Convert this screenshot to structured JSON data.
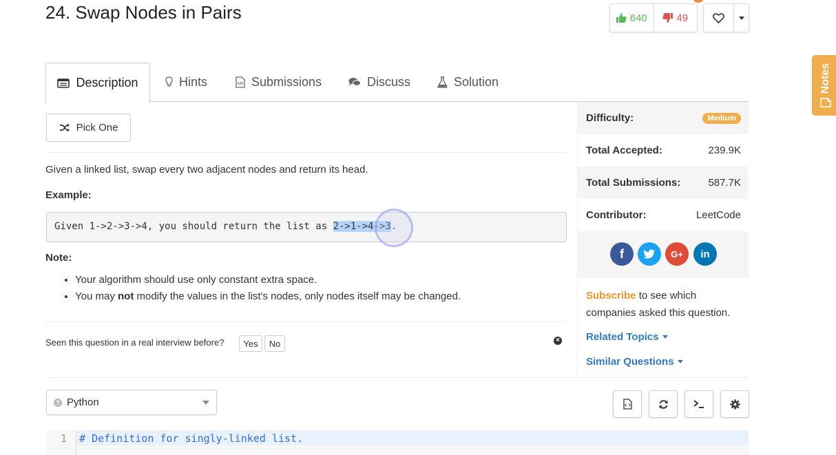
{
  "problem": {
    "title": "24. Swap Nodes in Pairs"
  },
  "votes": {
    "up": "640",
    "down": "49"
  },
  "tabs": [
    {
      "label": "Description",
      "icon": "description-icon"
    },
    {
      "label": "Hints",
      "icon": "lightbulb-icon"
    },
    {
      "label": "Submissions",
      "icon": "code-file-icon"
    },
    {
      "label": "Discuss",
      "icon": "comments-icon"
    },
    {
      "label": "Solution",
      "icon": "flask-icon"
    }
  ],
  "notes_tab": {
    "label": "Notes"
  },
  "pick_one": {
    "label": "Pick One"
  },
  "description": {
    "intro": "Given a linked list, swap every two adjacent nodes and return its head.",
    "example_heading": "Example:",
    "example_prefix": "Given 1->2->3->4, you should return the list as ",
    "example_highlight": "2->1->4->3",
    "example_suffix": ".",
    "note_heading": "Note:",
    "note_1": "Your algorithm should use only constant extra space.",
    "note_2_a": "You may ",
    "note_2_bold": "not",
    "note_2_b": " modify the values in the list's nodes, only nodes itself may be changed."
  },
  "interview": {
    "question": "Seen this question in a real interview before?",
    "yes": "Yes",
    "no": "No"
  },
  "sidebar": {
    "difficulty_label": "Difficulty:",
    "difficulty_value": "Medium",
    "accepted_label": "Total Accepted:",
    "accepted_value": "239.9K",
    "submissions_label": "Total Submissions:",
    "submissions_value": "587.7K",
    "contributor_label": "Contributor:",
    "contributor_value": "LeetCode",
    "subscribe_link": "Subscribe",
    "subscribe_text": " to see which companies asked this question.",
    "related_topics": "Related Topics",
    "similar_questions": "Similar Questions"
  },
  "social": [
    {
      "name": "facebook-icon",
      "glyph": "f",
      "color": "#3b5998"
    },
    {
      "name": "twitter-icon",
      "glyph": "t",
      "color": "#1da1f2"
    },
    {
      "name": "google-plus-icon",
      "glyph": "G+",
      "color": "#dd4b39"
    },
    {
      "name": "linkedin-icon",
      "glyph": "in",
      "color": "#0077b5"
    }
  ],
  "editor": {
    "language": "Python",
    "line_number": "1",
    "line_1": "# Definition for singly-linked list."
  },
  "colors": {
    "accent": "#f0ad4e",
    "link": "#337ab7",
    "upvote": "#5cb85c",
    "downvote": "#d9534f"
  }
}
